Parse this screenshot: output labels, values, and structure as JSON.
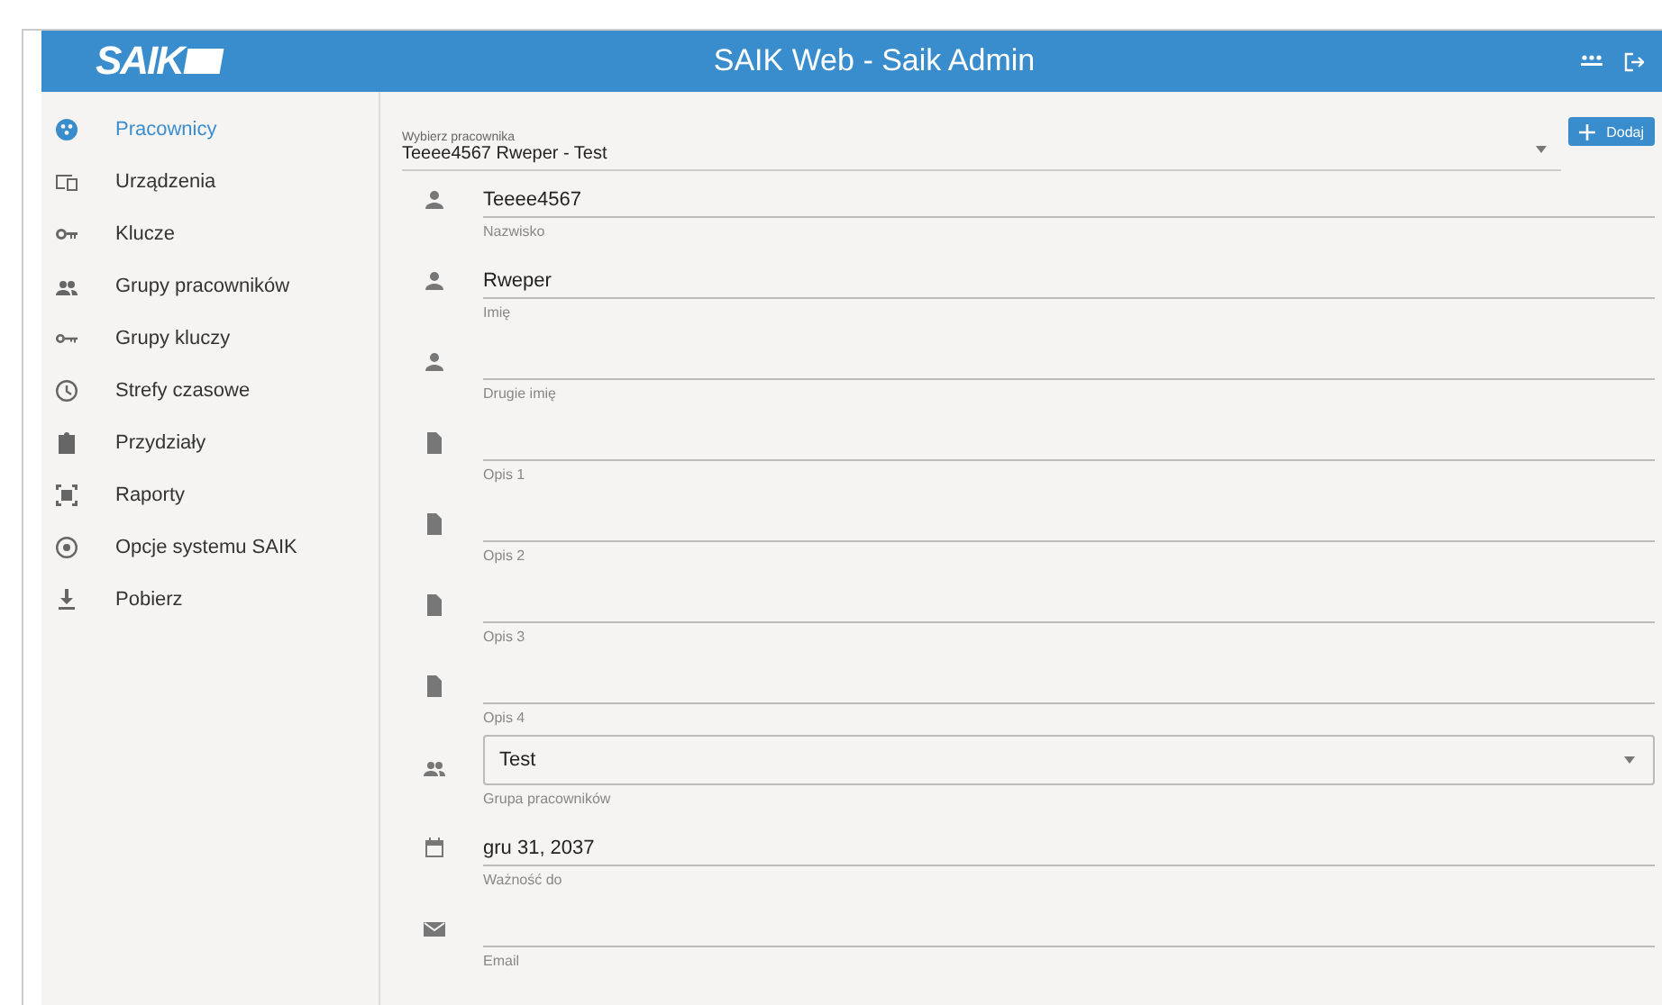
{
  "header": {
    "logo": "SAIK",
    "title": "SAIK Web - Saik Admin"
  },
  "sidebar": {
    "items": [
      {
        "label": "Pracownicy",
        "kind": "workers",
        "selected": true
      },
      {
        "label": "Urządzenia",
        "kind": "devices",
        "selected": false
      },
      {
        "label": "Klucze",
        "kind": "keys",
        "selected": false
      },
      {
        "label": "Grupy pracowników",
        "kind": "group",
        "selected": false
      },
      {
        "label": "Grupy kluczy",
        "kind": "key",
        "selected": false
      },
      {
        "label": "Strefy czasowe",
        "kind": "clock",
        "selected": false
      },
      {
        "label": "Przydziały",
        "kind": "clipboard",
        "selected": false
      },
      {
        "label": "Raporty",
        "kind": "frame",
        "selected": false
      },
      {
        "label": "Opcje systemu SAIK",
        "kind": "radio",
        "selected": false
      },
      {
        "label": "Pobierz",
        "kind": "download",
        "selected": false
      }
    ]
  },
  "picker": {
    "label": "Wybierz pracownika",
    "value": "Teeee4567 Rweper - Test",
    "button": "Dodaj"
  },
  "fields": [
    {
      "kind": "person",
      "value": "Teeee4567",
      "label": "Nazwisko"
    },
    {
      "kind": "person",
      "value": "Rweper",
      "label": "Imię"
    },
    {
      "kind": "person",
      "label": "Drugie imię"
    },
    {
      "kind": "document",
      "label": "Opis 1"
    },
    {
      "kind": "document",
      "label": "Opis 2"
    },
    {
      "kind": "document",
      "label": "Opis 3"
    },
    {
      "kind": "document",
      "label": "Opis 4"
    },
    {
      "kind": "group",
      "value": "Test",
      "label": "Grupa pracowników",
      "select": true
    },
    {
      "kind": "date",
      "value": "gru 31, 2037",
      "label": "Ważność do"
    },
    {
      "kind": "email",
      "label": "Email"
    }
  ]
}
